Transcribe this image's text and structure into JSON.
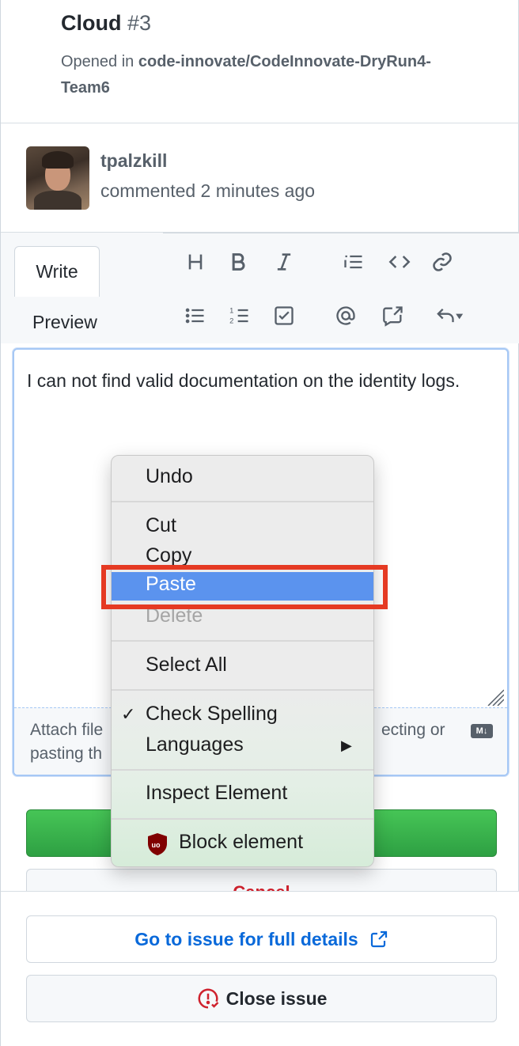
{
  "issue": {
    "title": "Cloud",
    "number": "#3",
    "opened_prefix": "Opened in",
    "repo": "code-innovate/CodeInnovate-DryRun4-Team6"
  },
  "comment": {
    "author": "tpalzkill",
    "timestamp": "commented 2 minutes ago",
    "body": "I can not find valid documentation on the identity logs."
  },
  "editor": {
    "tabs": [
      "Write",
      "Preview"
    ],
    "active_tab": "Write",
    "toolbar_icons": [
      "heading-icon",
      "bold-icon",
      "italic-icon",
      "quote-icon",
      "code-icon",
      "link-icon",
      "unordered-list-icon",
      "ordered-list-icon",
      "task-list-icon",
      "mention-icon",
      "reference-icon",
      "undo-icon"
    ],
    "attach_line1": "Attach file",
    "attach_line2": "pasting th",
    "attach_right": "ecting or",
    "markdown_badge": "M↓"
  },
  "buttons": {
    "cancel": "Cancel",
    "go_to_issue": "Go to issue for full details",
    "close_issue": "Close issue"
  },
  "context_menu": {
    "undo": "Undo",
    "cut": "Cut",
    "copy": "Copy",
    "paste": "Paste",
    "delete": "Delete",
    "select_all": "Select All",
    "check_spelling": "Check Spelling",
    "languages": "Languages",
    "inspect": "Inspect Element",
    "block": "Block element",
    "highlighted_item": "Paste"
  },
  "colors": {
    "accent_blue": "#0969da",
    "submit_green": "#2ea043",
    "danger_red": "#cf222e",
    "highlight": "#5b93ee",
    "annotation_red": "#e53a23"
  }
}
